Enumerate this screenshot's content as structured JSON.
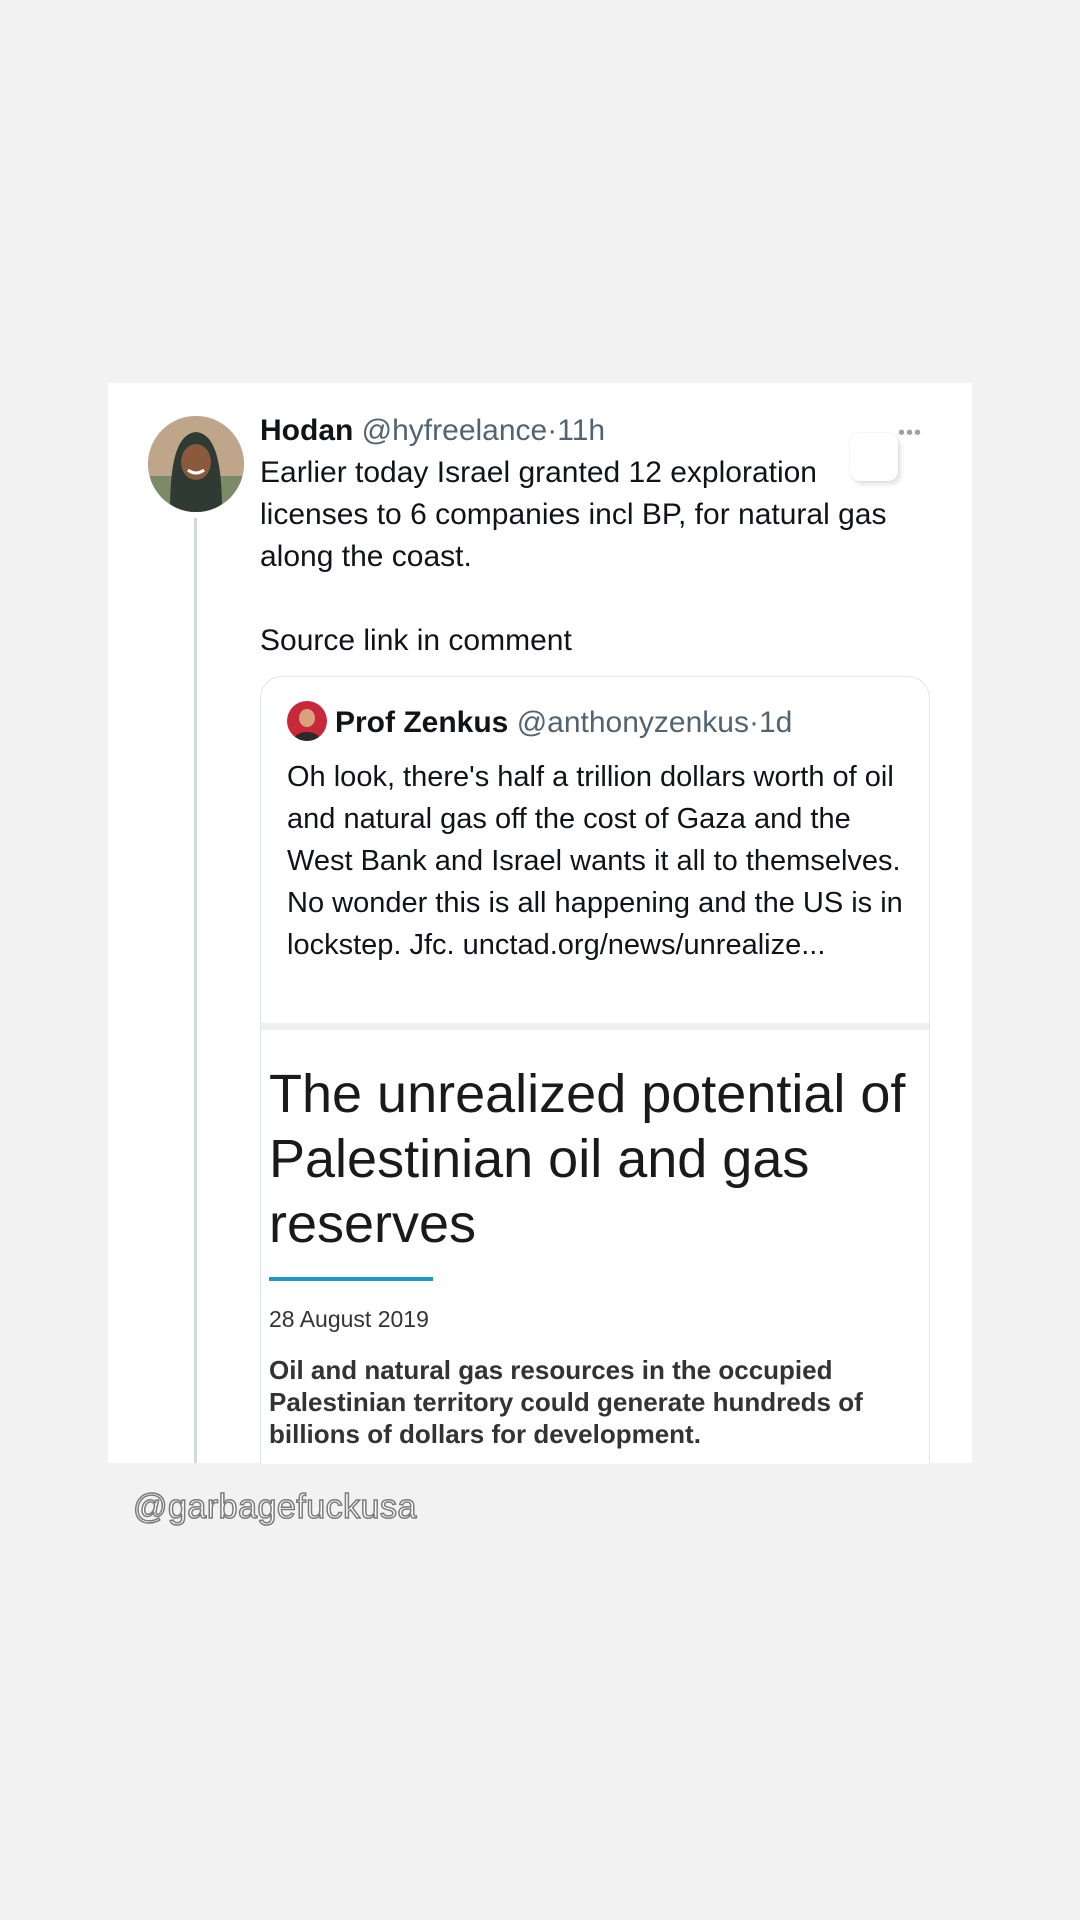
{
  "tweet": {
    "author_name": "Hodan",
    "handle": "@hyfreelance",
    "separator": "·",
    "time": "11h",
    "text": "Earlier today Israel granted 12 exploration licenses to 6 companies incl BP, for natural gas along the coast.\n\nSource link in comment",
    "more_icon": "more-horizontal-icon"
  },
  "quote": {
    "author_name": "Prof Zenkus",
    "handle": "@anthonyzenkus",
    "separator": "·",
    "time": "1d",
    "text": "Oh look, there's half a trillion dollars worth of oil and natural gas off the cost of Gaza and the West Bank and Israel wants it all to themselves. No wonder this is all happening and the US is in lockstep. Jfc. unctad.org/news/unrealize...",
    "article": {
      "title": "The unrealized potential of Palestinian oil and gas reserves",
      "date": "28 August 2019",
      "summary": "Oil and natural gas resources in the occupied Palestinian territory could generate hundreds of billions of dollars for development."
    }
  },
  "watermark": "@garbagefuckusa",
  "colors": {
    "background": "#f2f2f3",
    "card": "#ffffff",
    "secondary_text": "#536471",
    "thread_line": "#cfd9de",
    "accent_rule": "#1e96c8"
  }
}
